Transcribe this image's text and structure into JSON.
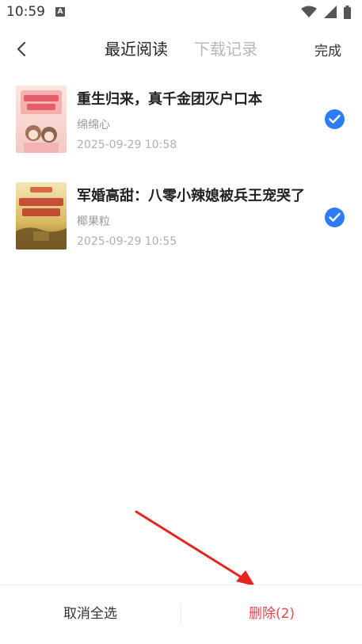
{
  "status_bar": {
    "time": "10:59",
    "notif_letter": "A"
  },
  "header": {
    "tabs": [
      {
        "label": "最近阅读",
        "active": true
      },
      {
        "label": "下载记录",
        "active": false
      }
    ],
    "done_label": "完成"
  },
  "books": [
    {
      "title": "重生归来，真千金团灭户口本",
      "author": "绵绵心",
      "date": "2025-09-29 10:58",
      "selected": true
    },
    {
      "title": "军婚高甜：八零小辣媳被兵王宠哭了",
      "author": "椰果粒",
      "date": "2025-09-29 10:55",
      "selected": true
    }
  ],
  "bottom": {
    "cancel_all_label": "取消全选",
    "delete_label": "删除(2)"
  },
  "colors": {
    "accent_blue": "#2b7cf6",
    "delete_red": "#e5484d",
    "inactive_tab": "#b8b8b8"
  }
}
